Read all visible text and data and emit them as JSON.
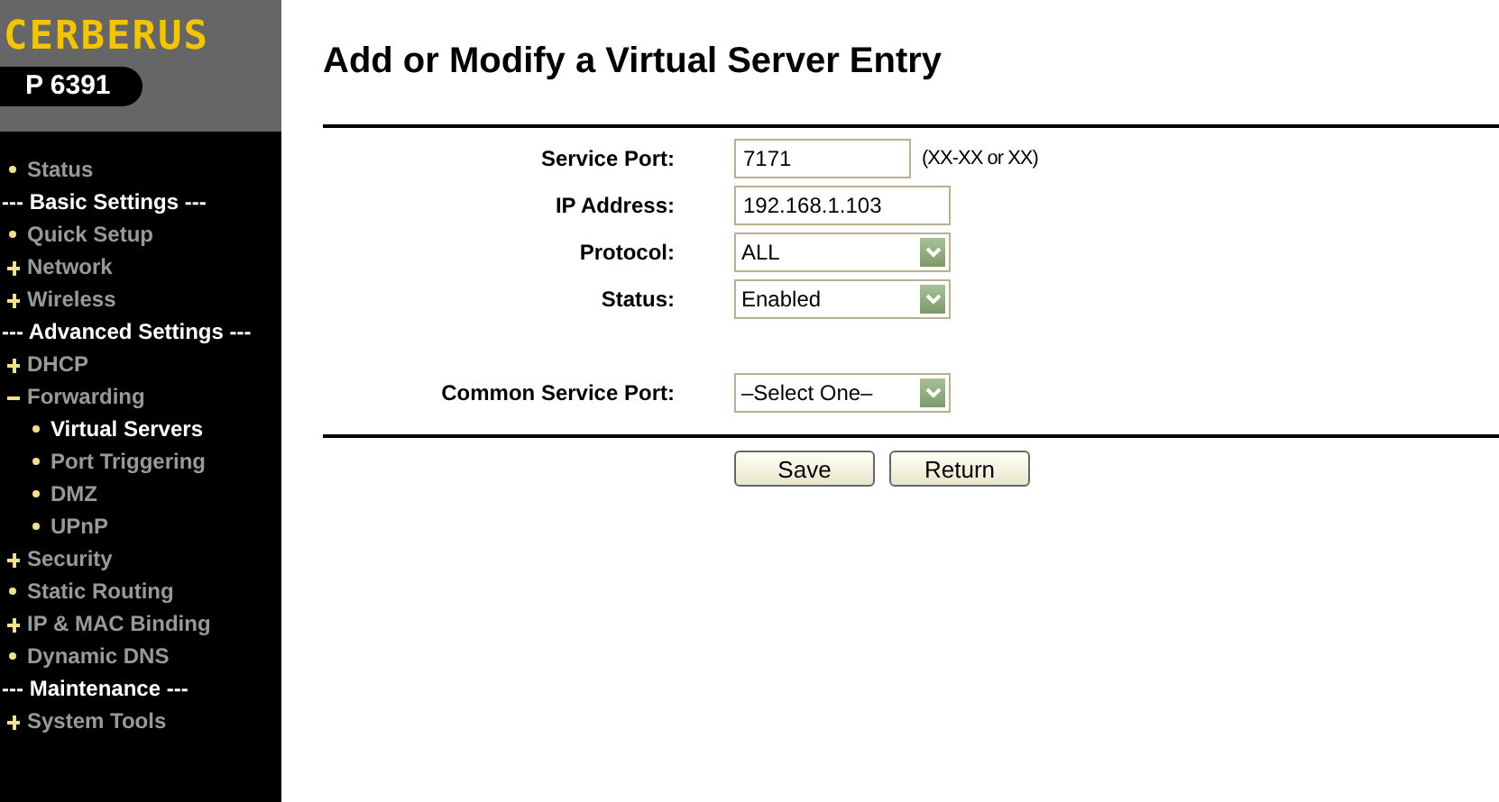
{
  "logo": {
    "brand": "CERBERUS",
    "model": "P 6391"
  },
  "sidebar": {
    "items": [
      {
        "kind": "link",
        "label": "Status",
        "selected": false
      },
      {
        "kind": "heading",
        "label": "--- Basic Settings ---"
      },
      {
        "kind": "link",
        "label": "Quick Setup",
        "selected": false
      },
      {
        "kind": "link",
        "label": "Network",
        "selected": false,
        "expanded": false
      },
      {
        "kind": "link",
        "label": "Wireless",
        "selected": false,
        "expanded": false
      },
      {
        "kind": "heading",
        "label": "--- Advanced Settings ---"
      },
      {
        "kind": "link",
        "label": "DHCP",
        "selected": false,
        "expanded": false
      },
      {
        "kind": "link",
        "label": "Forwarding",
        "selected": false,
        "expanded": true,
        "children": [
          {
            "label": "Virtual Servers",
            "selected": true
          },
          {
            "label": "Port Triggering",
            "selected": false
          },
          {
            "label": "DMZ",
            "selected": false
          },
          {
            "label": "UPnP",
            "selected": false
          }
        ]
      },
      {
        "kind": "link",
        "label": "Security",
        "selected": false,
        "expanded": false
      },
      {
        "kind": "link",
        "label": "Static Routing",
        "selected": false
      },
      {
        "kind": "link",
        "label": "IP & MAC Binding",
        "selected": false,
        "expanded": false
      },
      {
        "kind": "link",
        "label": "Dynamic DNS",
        "selected": false
      },
      {
        "kind": "heading",
        "label": "--- Maintenance ---"
      },
      {
        "kind": "link",
        "label": "System Tools",
        "selected": false,
        "expanded": false
      }
    ]
  },
  "page": {
    "title": "Add or Modify a Virtual Server Entry",
    "fields": [
      {
        "kind": "text",
        "label": "Service Port:",
        "value": "7171",
        "hint": "(XX-XX or XX)"
      },
      {
        "kind": "text",
        "label": "IP Address:",
        "value": "192.168.1.103"
      },
      {
        "kind": "select",
        "label": "Protocol:",
        "value": "ALL"
      },
      {
        "kind": "select",
        "label": "Status:",
        "value": "Enabled"
      },
      {
        "kind": "gap"
      },
      {
        "kind": "select",
        "label": "Common Service Port:",
        "value": "–Select One–"
      }
    ],
    "buttons": [
      "Save",
      "Return"
    ]
  }
}
